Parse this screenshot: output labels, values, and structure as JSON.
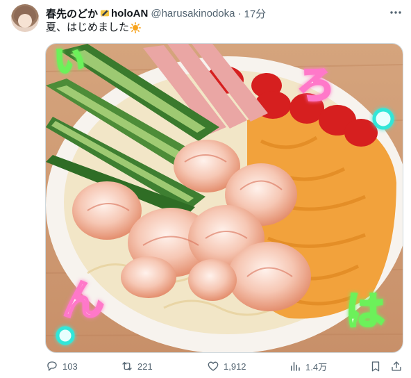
{
  "tweet": {
    "display_name": "春先のどか",
    "org": "holoAN",
    "handle": "@harusakinodoka",
    "separator": "·",
    "time": "17分",
    "text": "夏、はじめました"
  },
  "image": {
    "overlay_text": [
      "い",
      "ろ",
      "ん",
      "は"
    ]
  },
  "actions": {
    "replies": "103",
    "reposts": "221",
    "likes": "1,912",
    "views": "1.4万"
  },
  "colors": {
    "text": "#0f1419",
    "muted": "#536471",
    "accent_link": "#1d9bf0"
  },
  "icons": [
    "avatar",
    "pencil-emoji",
    "more-icon",
    "sun-emoji",
    "reply-icon",
    "repost-icon",
    "like-icon",
    "views-icon",
    "bookmark-icon",
    "share-icon"
  ]
}
